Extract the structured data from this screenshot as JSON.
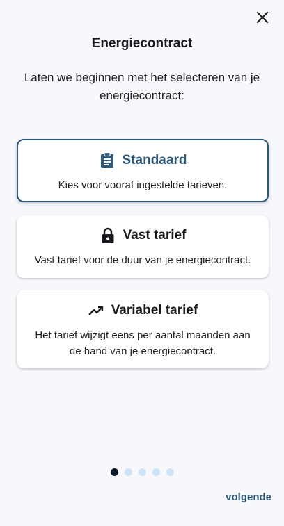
{
  "header": {
    "title": "Energiecontract",
    "subtitle": "Laten we beginnen met het selecteren van je energiecontract:",
    "close_icon": "close-icon"
  },
  "options": [
    {
      "title": "Standaard",
      "description": "Kies voor vooraf ingestelde tarieven.",
      "icon": "clipboard-icon",
      "selected": true
    },
    {
      "title": "Vast tarief",
      "description": "Vast tarief voor de duur van je energiecontract.",
      "icon": "lock-icon",
      "selected": false
    },
    {
      "title": "Variabel tarief",
      "description": "Het tarief wijzigt eens per aantal maanden aan de hand van je energiecontract.",
      "icon": "trending-up-icon",
      "selected": false
    }
  ],
  "pagination": {
    "total": 5,
    "current": 1
  },
  "footer": {
    "next_label": "volgende"
  },
  "colors": {
    "accent": "#2e5878",
    "dot_active": "#0f1a2a",
    "dot_inactive": "#cfe3f8",
    "background": "#f7f8fc"
  }
}
